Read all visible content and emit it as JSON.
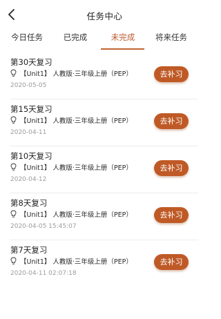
{
  "header": {
    "title": "任务中心"
  },
  "tabs": [
    {
      "label": "今日任务",
      "active": false
    },
    {
      "label": "已完成",
      "active": false
    },
    {
      "label": "未完成",
      "active": true
    },
    {
      "label": "将来任务",
      "active": false
    }
  ],
  "accent_color": "#c0652f",
  "items": [
    {
      "title": "第30天复习",
      "desc": "【Unit1】 人教版·三年级上册（PEP）",
      "date": "2020-05-05",
      "button": "去补习"
    },
    {
      "title": "第15天复习",
      "desc": "【Unit1】 人教版·三年级上册（PEP）",
      "date": "2020-04-11",
      "button": "去补习"
    },
    {
      "title": "第10天复习",
      "desc": "【Unit1】 人教版·三年级上册（PEP）",
      "date": "2020-04-12",
      "button": "去补习"
    },
    {
      "title": "第8天复习",
      "desc": "【Unit1】 人教版·三年级上册（PEP）",
      "date": "2020-04-05 15:45:07",
      "button": "去补习"
    },
    {
      "title": "第7天复习",
      "desc": "【Unit1】 人教版·三年级上册（PEP）",
      "date": "2020-04-11 02:07:18",
      "button": "去补习"
    }
  ]
}
